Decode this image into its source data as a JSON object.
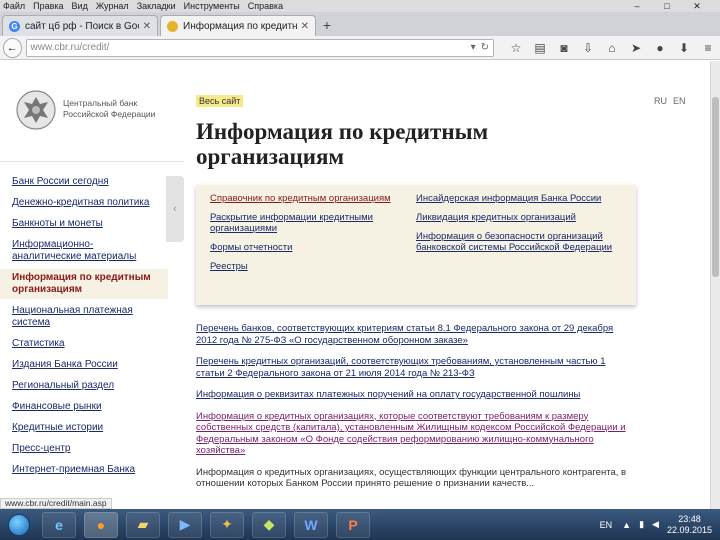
{
  "browser": {
    "menu": [
      "Файл",
      "Правка",
      "Вид",
      "Журнал",
      "Закладки",
      "Инструменты",
      "Справка"
    ],
    "tabs": [
      {
        "title": "сайт цб рф - Поиск в Goo...",
        "active": false
      },
      {
        "title": "Информация по кредитны...",
        "active": true
      }
    ],
    "url": "www.cbr.ru/credit/",
    "status_url": "www.cbr.ru/credit/main.asp"
  },
  "logo": {
    "text": "Центральный банк Российской Федерации"
  },
  "header": {
    "site_link": "Весь сайт",
    "lang_ru": "RU",
    "lang_en": "EN",
    "title": "Информация по кредитным организациям"
  },
  "sidebar": {
    "items": [
      {
        "label": "Банк России сегодня",
        "active": false
      },
      {
        "label": "Денежно-кредитная политика",
        "active": false
      },
      {
        "label": "Банкноты и монеты",
        "active": false
      },
      {
        "label": "Информационно-аналитические материалы",
        "active": false
      },
      {
        "label": "Информация по кредитным организациям",
        "active": true
      },
      {
        "label": "Национальная платежная система",
        "active": false
      },
      {
        "label": "Статистика",
        "active": false
      },
      {
        "label": "Издания Банка России",
        "active": false
      },
      {
        "label": "Региональный раздел",
        "active": false
      },
      {
        "label": "Финансовые рынки",
        "active": false
      },
      {
        "label": "Кредитные истории",
        "active": false
      },
      {
        "label": "Пресс-центр",
        "active": false
      },
      {
        "label": "Интернет-приемная Банка",
        "active": false
      }
    ]
  },
  "panel": {
    "col1": [
      {
        "label": "Справочник по кредитным организациям",
        "highlight": true
      },
      {
        "label": "Раскрытие информации кредитными организациями",
        "highlight": false
      },
      {
        "label": "Формы отчетности",
        "highlight": false
      },
      {
        "label": "Реестры",
        "highlight": false
      }
    ],
    "col2": [
      {
        "label": "Инсайдерская информация Банка России",
        "highlight": false
      },
      {
        "label": "Ликвидация кредитных организаций",
        "highlight": false
      },
      {
        "label": "Информация о безопасности организаций банковской системы Российской Федерации",
        "highlight": false
      }
    ]
  },
  "content": {
    "paragraphs": [
      {
        "text": "Перечень банков, соответствующих критериям статьи 8.1 Федерального закона от 29 декабря 2012 года № 275-ФЗ «О государственном оборонном заказе»",
        "kind": "link"
      },
      {
        "text": "Перечень кредитных организаций, соответствующих требованиям, установленным частью 1 статьи 2 Федерального закона от 21 июля 2014 года № 213-ФЗ",
        "kind": "link"
      },
      {
        "text": "Информация о реквизитах платежных поручений на оплату государственной пошлины",
        "kind": "link"
      },
      {
        "text": "Информация о кредитных организациях, которые соответствуют требованиям к размеру собственных средств (капитала), установленным Жилищным кодексом Российской Федерации и Федеральным законом «О Фонде содействия реформированию жилищно-коммунального хозяйства»",
        "kind": "visited"
      },
      {
        "text": "Информация о кредитных организациях, осуществляющих функции центрального контрагента, в отношении которых Банком России принято решение о признании качеств...",
        "kind": "plain"
      }
    ]
  },
  "taskbar": {
    "language": "EN",
    "time": "23:48",
    "date": "22.09.2015"
  }
}
